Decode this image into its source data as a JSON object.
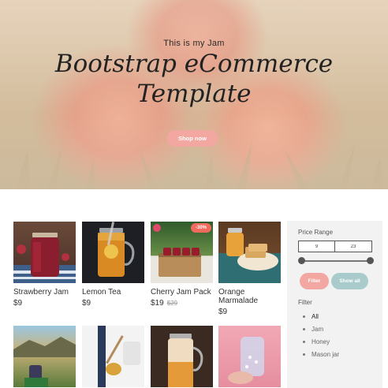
{
  "hero": {
    "subtitle": "This is my Jam",
    "title_line1": "Bootstrap eCommerce",
    "title_line2": "Template",
    "cta_label": "Shop now"
  },
  "products": [
    {
      "name": "Strawberry Jam",
      "price": "$9",
      "old_price": "",
      "badge": ""
    },
    {
      "name": "Lemon Tea",
      "price": "$9",
      "old_price": "",
      "badge": ""
    },
    {
      "name": "Cherry Jam Pack",
      "price": "$19",
      "old_price": "$29",
      "badge": "-30%"
    },
    {
      "name": "Orange Marmalade",
      "price": "$9",
      "old_price": "",
      "badge": ""
    }
  ],
  "sidebar": {
    "price_range_label": "Price Range",
    "min_value": "9",
    "max_value": "23",
    "filter_button": "Filter",
    "show_all_button": "Show all",
    "filter_label": "Filter",
    "categories": [
      {
        "label": "All",
        "active": true
      },
      {
        "label": "Jam",
        "active": false
      },
      {
        "label": "Honey",
        "active": false
      },
      {
        "label": "Mason jar",
        "active": false
      }
    ]
  },
  "colors": {
    "accent_pink": "#f2a8a1",
    "accent_teal": "#a9cbcb",
    "badge_red": "#f06a5d"
  }
}
